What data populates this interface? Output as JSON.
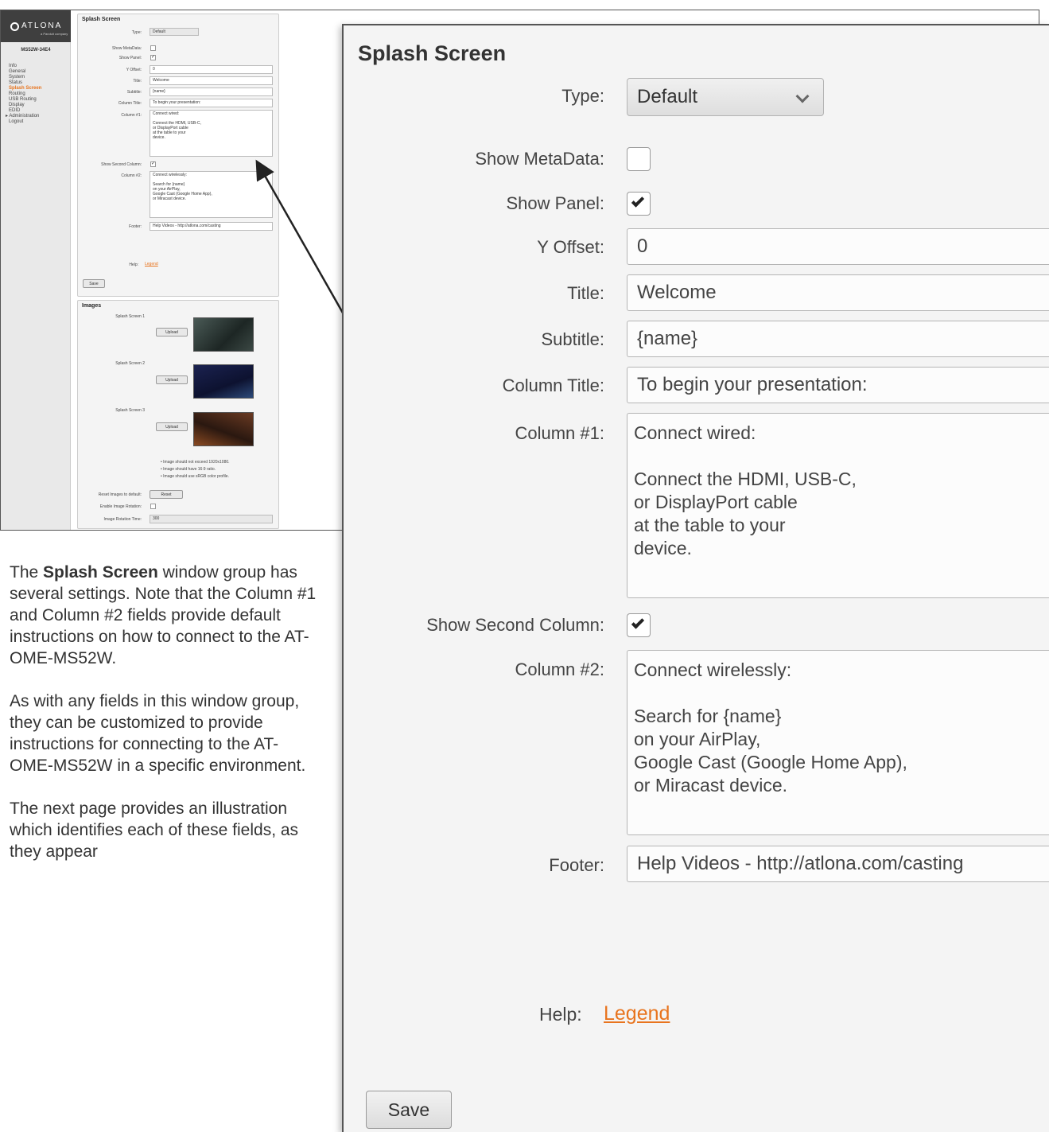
{
  "small": {
    "logo_text": "ATLONA",
    "logo_sub": "a Panduit company",
    "device": "MS52W-34E4",
    "nav": [
      "Info",
      "General",
      "System",
      "Status",
      "Splash Screen",
      "Routing",
      "USB Routing",
      "Display",
      "EDID",
      "▸ Administration",
      "Logout"
    ],
    "splash": {
      "title": "Splash Screen",
      "type_label": "Type:",
      "type_value": "Default",
      "show_metadata_label": "Show MetaData:",
      "show_panel_label": "Show Panel:",
      "y_offset_label": "Y Offset:",
      "y_offset": "0",
      "title_label": "Title:",
      "title_value": "Welcome",
      "subtitle_label": "Subtitle:",
      "subtitle_value": "{name}",
      "column_title_label": "Column Title:",
      "column_title_value": "To begin your presentation:",
      "column1_label": "Column #1:",
      "column1_value": "Connect wired:\n\nConnect the HDMI, USB-C,\nor DisplayPort cable\nat the table to your\ndevice.",
      "show_second_label": "Show Second Column:",
      "column2_label": "Column #2:",
      "column2_value": "Connect wirelessly:\n\nSearch for {name}\non your AirPlay,\nGoogle Cast (Google Home App),\nor Miracast device.",
      "footer_label": "Footer:",
      "footer_value": "Help Videos - http://atlona.com/casting",
      "help_label": "Help:",
      "legend": "Legend",
      "save": "Save"
    },
    "images": {
      "title": "Images",
      "screen1": "Splash Screen 1",
      "screen2": "Splash Screen 2",
      "screen3": "Splash Screen 3",
      "upload": "Upload",
      "note1": "• Image should not exceed 1920x1080.",
      "note2": "• Image should have 16:9 ratio.",
      "note3": "• Image should use sRGB color profile.",
      "reset_label": "Reset Images to default:",
      "reset": "Reset",
      "rotation_label": "Enable Image Rotation:",
      "rotation_time_label": "Image Rotation Time:",
      "rotation_time": "300"
    }
  },
  "description": {
    "p1_bold": "Splash Screen",
    "p1_rest": " window group has several settings. Note that the Column #1 and Column #2 fields provide default instructions on how to connect to the AT-OME-MS52W.",
    "p1_pre": "The ",
    "p2": "As with any fields in this window group, they can be customized to provide instructions for connecting to the AT-OME-MS52W in a specific environment.",
    "p3": "The next page provides an illustration which identifies each of these fields, as they appear"
  },
  "zoom": {
    "title": "Splash Screen",
    "type_label": "Type:",
    "type_value": "Default",
    "show_metadata_label": "Show MetaData:",
    "show_metadata": false,
    "show_panel_label": "Show Panel:",
    "show_panel": true,
    "y_offset_label": "Y Offset:",
    "y_offset": "0",
    "title_label": "Title:",
    "title_value": "Welcome",
    "subtitle_label": "Subtitle:",
    "subtitle_value": "{name}",
    "column_title_label": "Column Title:",
    "column_title_value": "To begin your presentation:",
    "column1_label": "Column #1:",
    "column1_value": "Connect wired:\n\nConnect the HDMI, USB-C,\nor DisplayPort cable\nat the table to your\ndevice.",
    "show_second_label": "Show Second Column:",
    "show_second": true,
    "column2_label": "Column #2:",
    "column2_value": "Connect wirelessly:\n\nSearch for {name}\non your AirPlay,\nGoogle Cast (Google Home App),\nor Miracast device.",
    "footer_label": "Footer:",
    "footer_value": "Help Videos - http://atlona.com/casting",
    "help_label": "Help:",
    "legend": "Legend",
    "save": "Save"
  },
  "colors": {
    "accent": "#e8741e",
    "panel_bg": "#f4f4f4",
    "sidebar_bg": "#e9e9e9",
    "logo_bg": "#3f3f3f"
  }
}
